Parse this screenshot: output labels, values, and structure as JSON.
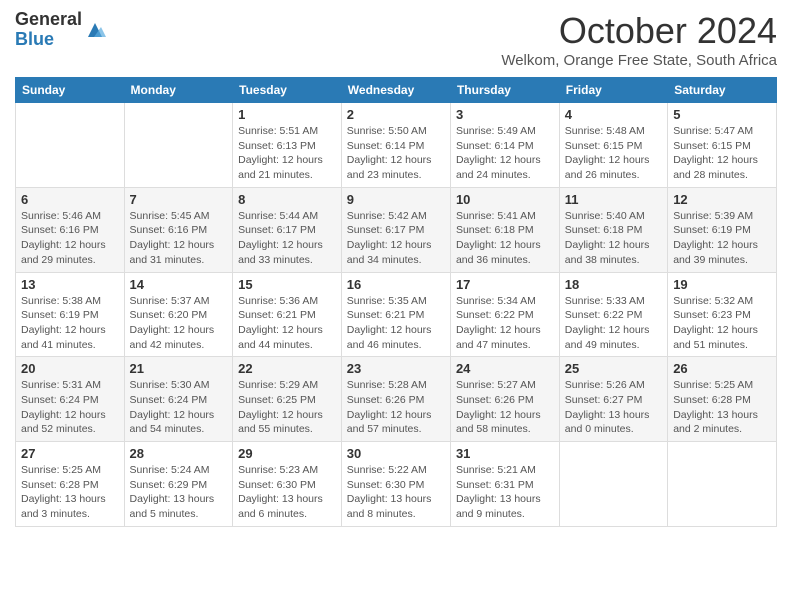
{
  "logo": {
    "general": "General",
    "blue": "Blue"
  },
  "header": {
    "month": "October 2024",
    "subtitle": "Welkom, Orange Free State, South Africa"
  },
  "days_of_week": [
    "Sunday",
    "Monday",
    "Tuesday",
    "Wednesday",
    "Thursday",
    "Friday",
    "Saturday"
  ],
  "weeks": [
    [
      {
        "day": "",
        "info": ""
      },
      {
        "day": "",
        "info": ""
      },
      {
        "day": "1",
        "info": "Sunrise: 5:51 AM\nSunset: 6:13 PM\nDaylight: 12 hours and 21 minutes."
      },
      {
        "day": "2",
        "info": "Sunrise: 5:50 AM\nSunset: 6:14 PM\nDaylight: 12 hours and 23 minutes."
      },
      {
        "day": "3",
        "info": "Sunrise: 5:49 AM\nSunset: 6:14 PM\nDaylight: 12 hours and 24 minutes."
      },
      {
        "day": "4",
        "info": "Sunrise: 5:48 AM\nSunset: 6:15 PM\nDaylight: 12 hours and 26 minutes."
      },
      {
        "day": "5",
        "info": "Sunrise: 5:47 AM\nSunset: 6:15 PM\nDaylight: 12 hours and 28 minutes."
      }
    ],
    [
      {
        "day": "6",
        "info": "Sunrise: 5:46 AM\nSunset: 6:16 PM\nDaylight: 12 hours and 29 minutes."
      },
      {
        "day": "7",
        "info": "Sunrise: 5:45 AM\nSunset: 6:16 PM\nDaylight: 12 hours and 31 minutes."
      },
      {
        "day": "8",
        "info": "Sunrise: 5:44 AM\nSunset: 6:17 PM\nDaylight: 12 hours and 33 minutes."
      },
      {
        "day": "9",
        "info": "Sunrise: 5:42 AM\nSunset: 6:17 PM\nDaylight: 12 hours and 34 minutes."
      },
      {
        "day": "10",
        "info": "Sunrise: 5:41 AM\nSunset: 6:18 PM\nDaylight: 12 hours and 36 minutes."
      },
      {
        "day": "11",
        "info": "Sunrise: 5:40 AM\nSunset: 6:18 PM\nDaylight: 12 hours and 38 minutes."
      },
      {
        "day": "12",
        "info": "Sunrise: 5:39 AM\nSunset: 6:19 PM\nDaylight: 12 hours and 39 minutes."
      }
    ],
    [
      {
        "day": "13",
        "info": "Sunrise: 5:38 AM\nSunset: 6:19 PM\nDaylight: 12 hours and 41 minutes."
      },
      {
        "day": "14",
        "info": "Sunrise: 5:37 AM\nSunset: 6:20 PM\nDaylight: 12 hours and 42 minutes."
      },
      {
        "day": "15",
        "info": "Sunrise: 5:36 AM\nSunset: 6:21 PM\nDaylight: 12 hours and 44 minutes."
      },
      {
        "day": "16",
        "info": "Sunrise: 5:35 AM\nSunset: 6:21 PM\nDaylight: 12 hours and 46 minutes."
      },
      {
        "day": "17",
        "info": "Sunrise: 5:34 AM\nSunset: 6:22 PM\nDaylight: 12 hours and 47 minutes."
      },
      {
        "day": "18",
        "info": "Sunrise: 5:33 AM\nSunset: 6:22 PM\nDaylight: 12 hours and 49 minutes."
      },
      {
        "day": "19",
        "info": "Sunrise: 5:32 AM\nSunset: 6:23 PM\nDaylight: 12 hours and 51 minutes."
      }
    ],
    [
      {
        "day": "20",
        "info": "Sunrise: 5:31 AM\nSunset: 6:24 PM\nDaylight: 12 hours and 52 minutes."
      },
      {
        "day": "21",
        "info": "Sunrise: 5:30 AM\nSunset: 6:24 PM\nDaylight: 12 hours and 54 minutes."
      },
      {
        "day": "22",
        "info": "Sunrise: 5:29 AM\nSunset: 6:25 PM\nDaylight: 12 hours and 55 minutes."
      },
      {
        "day": "23",
        "info": "Sunrise: 5:28 AM\nSunset: 6:26 PM\nDaylight: 12 hours and 57 minutes."
      },
      {
        "day": "24",
        "info": "Sunrise: 5:27 AM\nSunset: 6:26 PM\nDaylight: 12 hours and 58 minutes."
      },
      {
        "day": "25",
        "info": "Sunrise: 5:26 AM\nSunset: 6:27 PM\nDaylight: 13 hours and 0 minutes."
      },
      {
        "day": "26",
        "info": "Sunrise: 5:25 AM\nSunset: 6:28 PM\nDaylight: 13 hours and 2 minutes."
      }
    ],
    [
      {
        "day": "27",
        "info": "Sunrise: 5:25 AM\nSunset: 6:28 PM\nDaylight: 13 hours and 3 minutes."
      },
      {
        "day": "28",
        "info": "Sunrise: 5:24 AM\nSunset: 6:29 PM\nDaylight: 13 hours and 5 minutes."
      },
      {
        "day": "29",
        "info": "Sunrise: 5:23 AM\nSunset: 6:30 PM\nDaylight: 13 hours and 6 minutes."
      },
      {
        "day": "30",
        "info": "Sunrise: 5:22 AM\nSunset: 6:30 PM\nDaylight: 13 hours and 8 minutes."
      },
      {
        "day": "31",
        "info": "Sunrise: 5:21 AM\nSunset: 6:31 PM\nDaylight: 13 hours and 9 minutes."
      },
      {
        "day": "",
        "info": ""
      },
      {
        "day": "",
        "info": ""
      }
    ]
  ]
}
